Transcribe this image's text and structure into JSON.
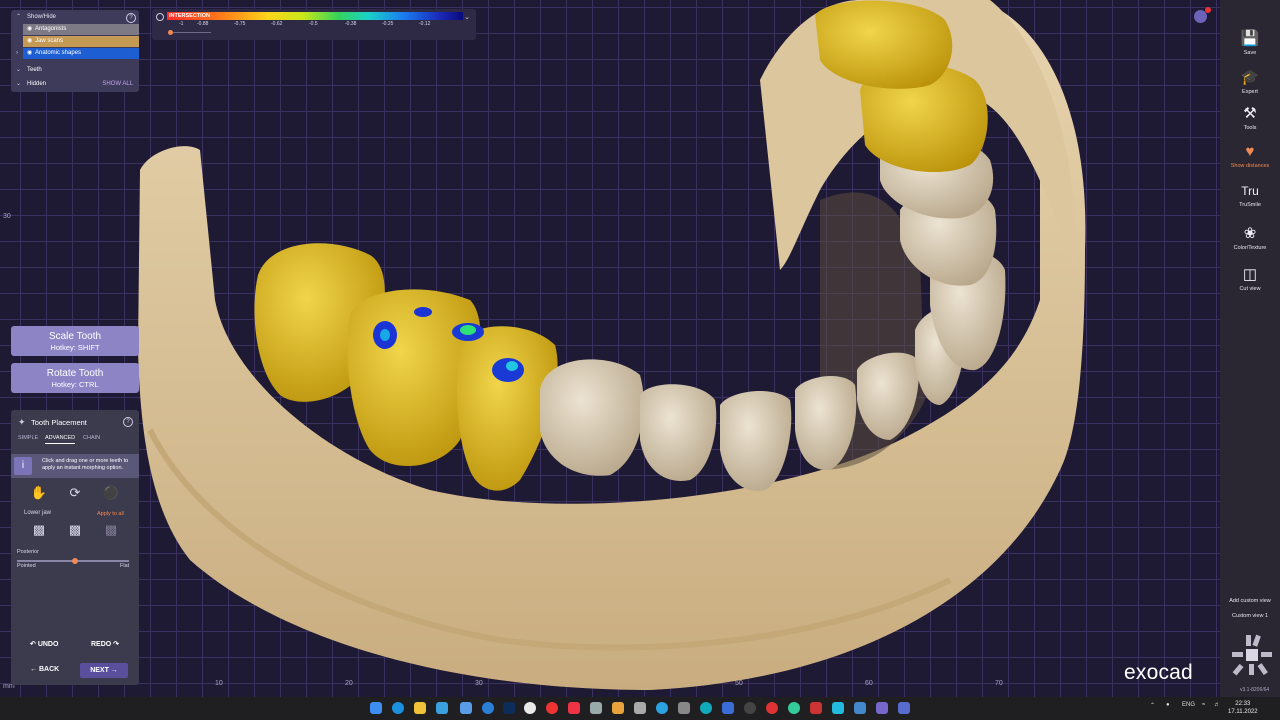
{
  "window": {
    "title": "exocad"
  },
  "show_hide": {
    "title": "Show/Hide",
    "items": [
      {
        "label": "Antagonists"
      },
      {
        "label": "Jaw scans"
      },
      {
        "label": "Anatomic shapes"
      }
    ],
    "teeth_label": "Teeth",
    "hidden_label": "Hidden",
    "show_all": "SHOW ALL"
  },
  "intersection": {
    "title": "INTERSECTION",
    "ticks": [
      "-1",
      "-0.88",
      "-0.75",
      "-0.62",
      "-0.5",
      "-0.38",
      "-0.25",
      "-0.12"
    ]
  },
  "buttons": {
    "scale_title": "Scale Tooth",
    "scale_hotkey": "Hotkey: SHIFT",
    "rotate_title": "Rotate Tooth",
    "rotate_hotkey": "Hotkey: CTRL"
  },
  "tooth_placement": {
    "title": "Tooth Placement",
    "tabs": [
      "SIMPLE",
      "ADVANCED",
      "CHAIN"
    ],
    "active_tab": "ADVANCED",
    "info": "Click and drag one or more teeth to apply an instant morphing option.",
    "lower_jaw": "Lower jaw",
    "apply_all": "Apply to all",
    "posterior": "Posterior",
    "pointed": "Pointed",
    "flat": "Flat",
    "slider_value": 0.5,
    "undo": "UNDO",
    "redo": "REDO",
    "back": "BACK",
    "next": "NEXT"
  },
  "sidebar": {
    "items": [
      {
        "label": "Save",
        "icon": "save-icon"
      },
      {
        "label": "Expert",
        "icon": "expert-icon"
      },
      {
        "label": "Tools",
        "icon": "tools-icon"
      },
      {
        "label": "Show distances",
        "icon": "show-distances-icon"
      },
      {
        "label": "TruSmile",
        "icon": "trusmile-icon"
      },
      {
        "label": "Color/Texture",
        "icon": "color-texture-icon"
      },
      {
        "label": "Cut view",
        "icon": "cut-view-icon"
      }
    ],
    "active": "Show distances",
    "add_custom_view": "Add custom view",
    "custom_view": "Custom view 1",
    "version": "v3.1-8206/64"
  },
  "viewport": {
    "axis_x": [
      "10",
      "20",
      "30",
      "40",
      "50",
      "60",
      "70"
    ],
    "axis_y_top": "30",
    "axis_y_mid": "40",
    "unit": "mm",
    "logo": "exocad"
  },
  "taskbar": {
    "lang": "ENG",
    "time": "22:33",
    "date": "17.11.2022"
  },
  "colors": {
    "accent": "#f08a55",
    "panel": "#3b3756",
    "button": "#8d84c6",
    "jaw": "#d9c197",
    "crown": "#d4b018"
  }
}
